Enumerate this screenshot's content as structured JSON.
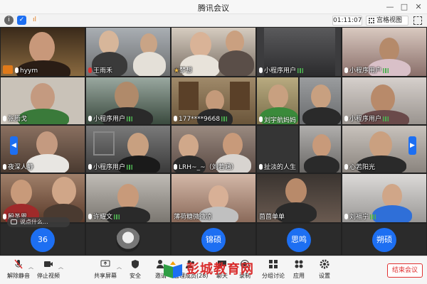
{
  "window": {
    "title": "腾讯会议"
  },
  "toolbar": {
    "timer": "01:11:07",
    "view_label": "宫格视图"
  },
  "participants": [
    {
      "name": "hyym",
      "bg": "#6a5030"
    },
    {
      "name": "王雨禾",
      "bg": "#8b8f93"
    },
    {
      "name": "梦想",
      "bg": "#9a8f84"
    },
    {
      "name": "",
      "bg": "#7a6a4a"
    },
    {
      "name": "小程序用户",
      "bg": "#3c3c3e"
    },
    {
      "name": "小程序用户",
      "bg": "#8a6f6a"
    },
    {
      "name": "张腾戈",
      "bg": "#c9c2b8"
    },
    {
      "name": "小程序用户",
      "bg": "#6f7b70"
    },
    {
      "name": "177****9668",
      "bg": "#8a7355"
    },
    {
      "name": "刘宇航妈妈",
      "bg": "#a89a70"
    },
    {
      "name": "",
      "bg": "#8a8c8e"
    },
    {
      "name": "小程序用户",
      "bg": "#bcb5b0"
    },
    {
      "name": "夜深人静",
      "bg": "#6a5448"
    },
    {
      "name": "小程序用户",
      "bg": "#5b5b5b"
    },
    {
      "name": "LRH~_~（刘若涵）",
      "bg": "#7b6860"
    },
    {
      "name": "扯淡的人生",
      "bg": "#353535"
    },
    {
      "name": "",
      "bg": "#8c8a88"
    },
    {
      "name": "心若阳光",
      "bg": "#a7a09a"
    },
    {
      "name": "殷圣恩",
      "bg": "#7a4a3a"
    },
    {
      "name": "许耀文",
      "bg": "#96918a"
    },
    {
      "name": "薄荷糖微微凉",
      "bg": "#b59888"
    },
    {
      "name": "茴茴单单",
      "bg": "#5a5048"
    },
    {
      "name": "刘福宁",
      "bg": "#c4c2bf"
    }
  ],
  "avatars": [
    {
      "label": "36"
    },
    {
      "label": ""
    },
    {
      "label": "锦硕"
    },
    {
      "label": "思鸣"
    },
    {
      "label": "朔硕"
    }
  ],
  "comment": {
    "placeholder": "说点什么..."
  },
  "bottombar": {
    "mute": "解除静音",
    "video": "停止视频",
    "share": "共享屏幕",
    "security": "安全",
    "invite": "邀请",
    "members": "管理成员(28)",
    "chat": "聊天",
    "record": "录制",
    "breakout": "分组讨论",
    "apps": "应用",
    "settings": "设置",
    "end": "结束会议"
  },
  "watermark": "彭城教育网",
  "colors": {
    "accent": "#1d6ff2",
    "danger": "#e03131"
  }
}
